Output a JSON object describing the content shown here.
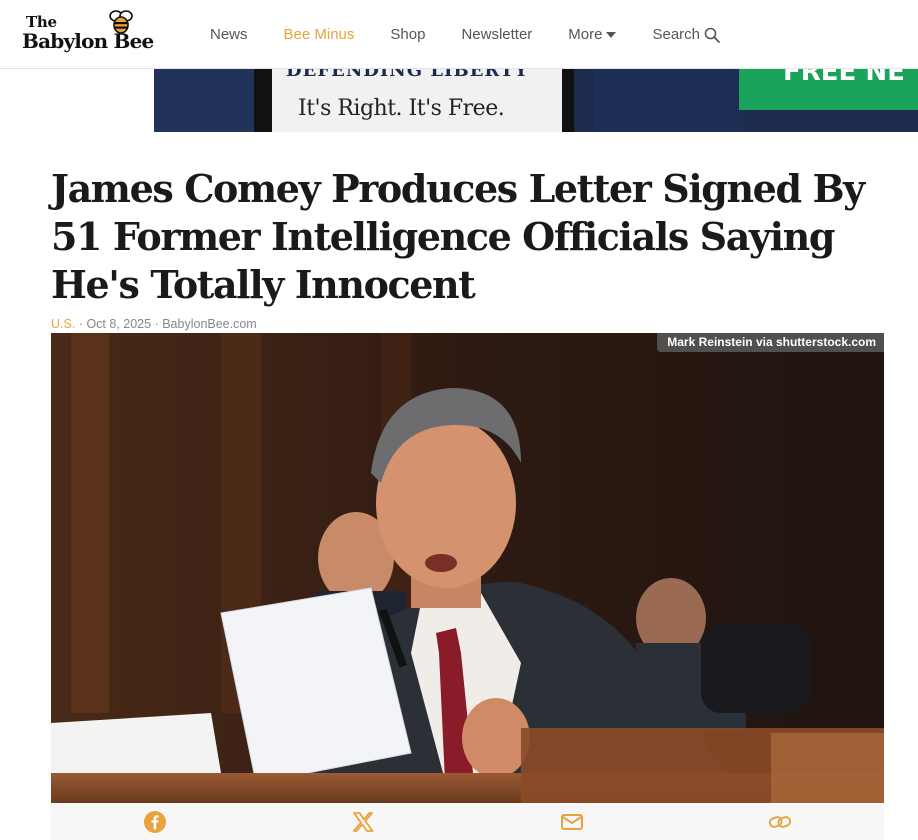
{
  "logo": {
    "line1": "The",
    "line2": "Babylon Bee"
  },
  "nav": {
    "items": [
      {
        "label": "News",
        "accent": false
      },
      {
        "label": "Bee Minus",
        "accent": true
      },
      {
        "label": "Shop",
        "accent": false
      },
      {
        "label": "Newsletter",
        "accent": false
      }
    ],
    "more_label": "More",
    "search_label": "Search"
  },
  "ad": {
    "card_top_text": "DEFENDING LIBERTY",
    "card_main_text": "It's Right. It's Free.",
    "green_text": "FREE NE"
  },
  "article": {
    "headline": "James Comey Produces Letter Signed By 51 Former Intelligence Officials Saying He's Totally Innocent",
    "category": "U.S.",
    "date": "Oct 8, 2025",
    "source": "BabylonBee.com",
    "separator": "·",
    "photo_credit": "Mark Reinstein via shutterstock.com"
  },
  "share": {
    "icons": [
      "facebook-icon",
      "x-icon",
      "email-icon",
      "link-icon"
    ],
    "color": "#e8a33d"
  },
  "colors": {
    "accent": "#e8a33d",
    "text": "#1a1a1a",
    "muted": "#888888"
  }
}
